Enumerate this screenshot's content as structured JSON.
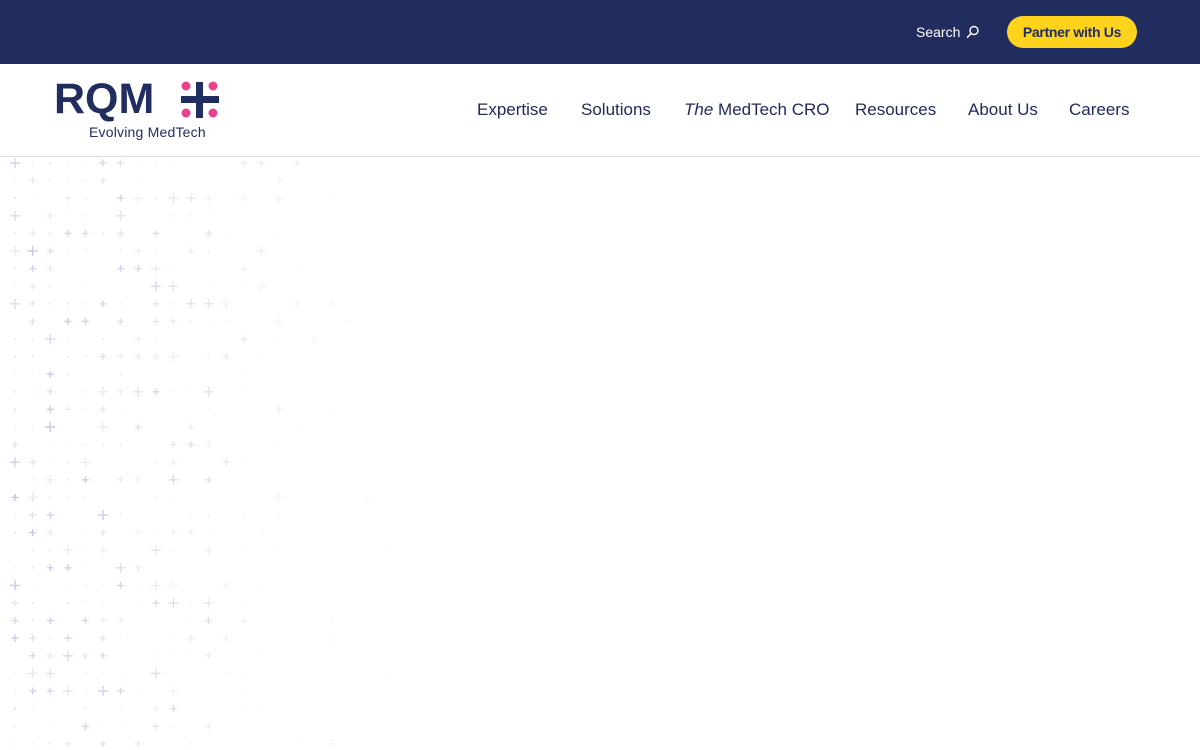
{
  "topbar": {
    "search_label": "Search",
    "search_icon": "search-icon",
    "partner_label": "Partner with Us",
    "background_color": "#212c5f",
    "accent_color": "#ffd21c"
  },
  "logo": {
    "wordmark": "RQM+",
    "tagline": "Evolving MedTech",
    "dot_color": "#e8418f"
  },
  "nav": {
    "items": [
      {
        "label": "Expertise"
      },
      {
        "label": "Solutions"
      },
      {
        "prefix": "The",
        "label": "MedTech CRO"
      },
      {
        "label": "Resources"
      },
      {
        "label": "About Us"
      },
      {
        "label": "Careers"
      }
    ]
  }
}
